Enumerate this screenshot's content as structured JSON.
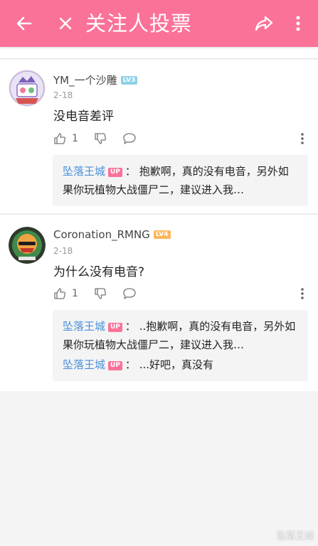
{
  "header": {
    "title": "关注人投票",
    "background": "#fb7299",
    "icons": [
      "back-arrow-icon",
      "close-icon",
      "share-icon",
      "more-vertical-icon"
    ]
  },
  "comments": [
    {
      "username": "YM_一个沙雕",
      "level": "LV3",
      "date": "2-18",
      "content": "没电音差评",
      "like_count": "1",
      "replies": [
        {
          "user": "坠落王城",
          "tag": "UP",
          "text": "：  抱歉啊，真的没有电音，另外如果你玩植物大战僵尸二，建议进入我…"
        }
      ]
    },
    {
      "username": "Coronation_RMNG",
      "level": "LV4",
      "date": "2-18",
      "content": "为什么没有电音?",
      "like_count": "1",
      "replies": [
        {
          "user": "坠落王城",
          "tag": "UP",
          "text": "：  ..抱歉啊，真的没有电音，另外如果你玩植物大战僵尸二，建议进入我…"
        },
        {
          "user": "坠落王城",
          "tag": "UP",
          "text": "：  ...好吧，真没有"
        }
      ]
    }
  ],
  "watermark": "坠落王城",
  "colors": {
    "accent": "#fb7299",
    "link": "#4a90d9",
    "lv3": "#8bd1e8",
    "lv4": "#feb65a"
  }
}
